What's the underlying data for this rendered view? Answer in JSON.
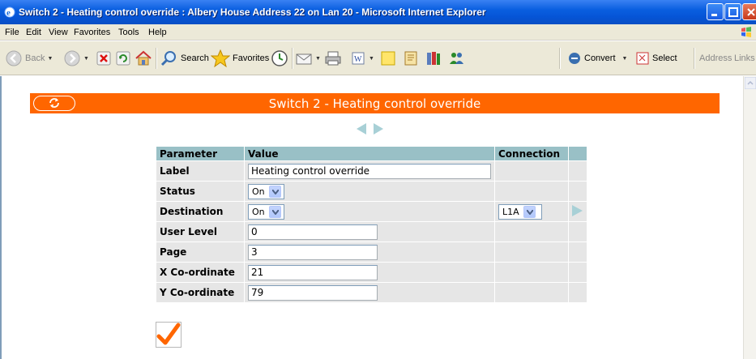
{
  "window": {
    "title": "Switch 2 - Heating control override : Albery House Address 22 on Lan 20 - Microsoft Internet Explorer"
  },
  "menu": {
    "items": [
      "File",
      "Edit",
      "View",
      "Favorites",
      "Tools",
      "Help"
    ]
  },
  "toolbar": {
    "back_label": "Back",
    "search_label": "Search",
    "favorites_label": "Favorites",
    "convert_label": "Convert",
    "select_label": "Select",
    "address_label": "Address",
    "links_label": "Links"
  },
  "page": {
    "header_title": "Switch 2 - Heating control override",
    "table": {
      "headers": {
        "parameter": "Parameter",
        "value": "Value",
        "connection": "Connection"
      },
      "rows": {
        "label": {
          "name": "Label",
          "value": "Heating control override"
        },
        "status": {
          "name": "Status",
          "value": "On"
        },
        "destination": {
          "name": "Destination",
          "value": "On",
          "connection": "L1A"
        },
        "user_level": {
          "name": "User Level",
          "value": "0"
        },
        "page": {
          "name": "Page",
          "value": "3"
        },
        "x_coord": {
          "name": "X Co-ordinate",
          "value": "21"
        },
        "y_coord": {
          "name": "Y Co-ordinate",
          "value": "79"
        }
      }
    }
  },
  "colors": {
    "accent": "#ff6600",
    "table_header": "#99c0c6",
    "table_cell": "#e6e6e6",
    "titlebar": "#0554d6"
  }
}
